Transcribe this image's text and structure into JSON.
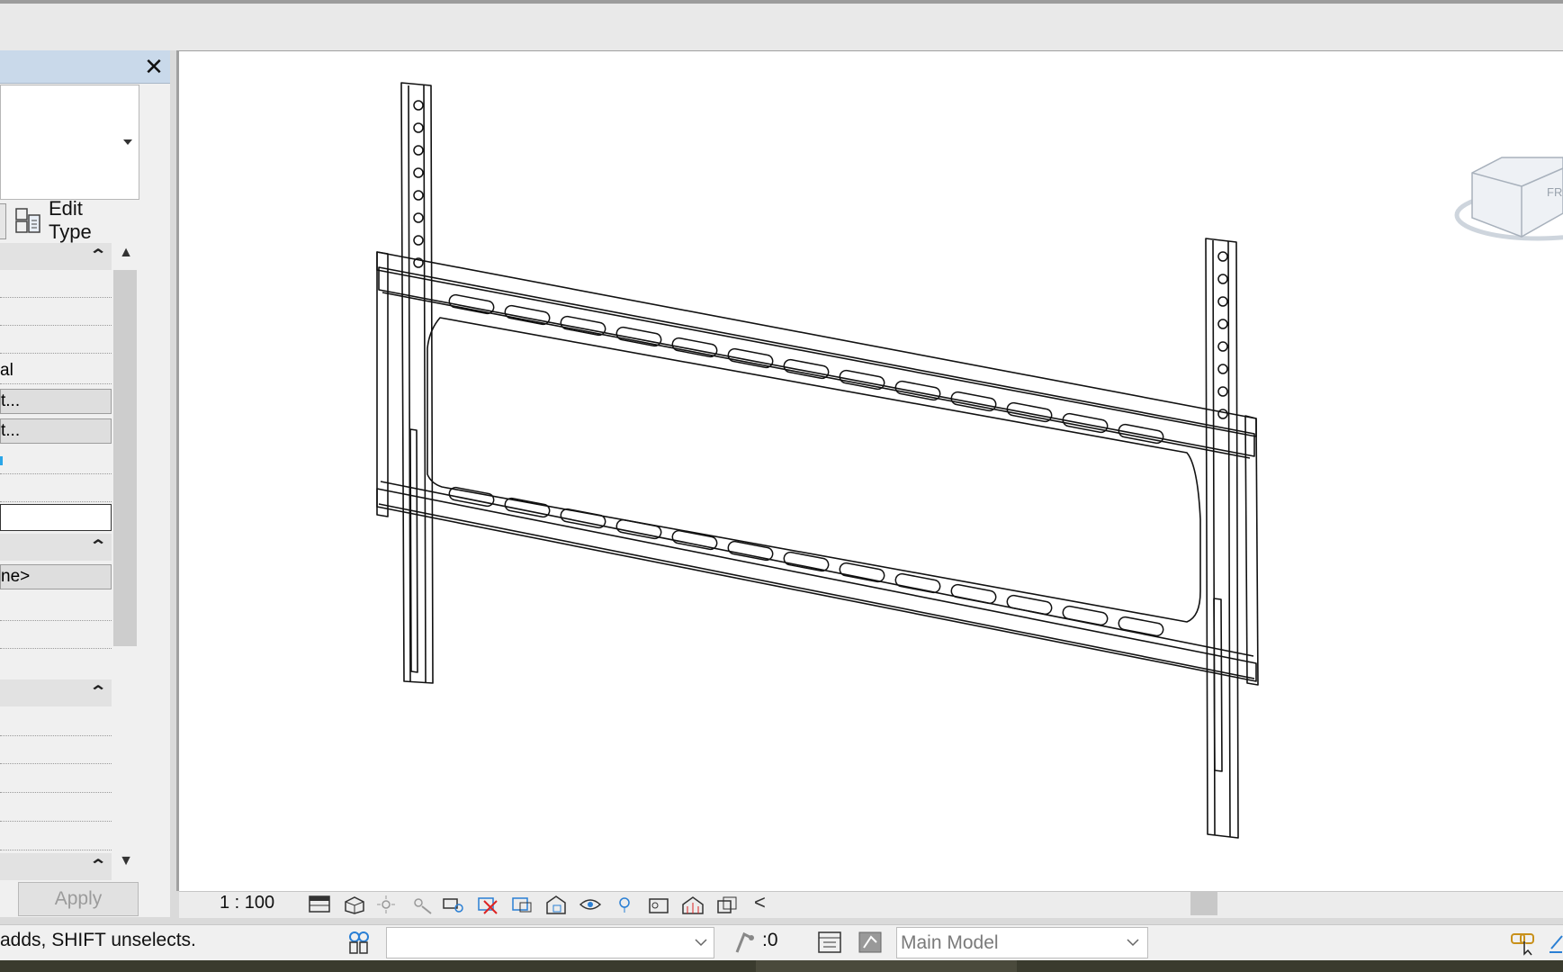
{
  "properties_palette": {
    "close_glyph": "✕",
    "edit_type_label": "Edit Type",
    "groups": [
      {
        "collapse_glyph": "⌃"
      },
      {
        "collapse_glyph": "⌃"
      },
      {
        "collapse_glyph": "⌃"
      },
      {
        "collapse_glyph": "⌃"
      }
    ],
    "rows": [
      "",
      "",
      "",
      "al",
      "t...",
      "t...",
      "",
      "",
      "",
      "ne>",
      "",
      "",
      "",
      "",
      "",
      "",
      "",
      ""
    ],
    "apply_label": "Apply"
  },
  "view_control_bar": {
    "scale": "1 : 100",
    "icons": [
      "detail-level-icon",
      "visual-style-icon",
      "sun-path-icon",
      "shadows-icon",
      "show-rendering-icon",
      "crop-view-icon",
      "show-crop-region-icon",
      "unlock-3d-view-icon",
      "temporary-hide-icon",
      "reveal-hidden-icon",
      "temporary-view-properties-icon",
      "show-analytical-model-icon",
      "highlight-displacement-icon",
      "reveal-constraints-icon"
    ],
    "collapse_glyph": "<"
  },
  "status_bar": {
    "message": "adds, SHIFT unselects.",
    "workset_value": "",
    "press_drag_count": ":0",
    "main_model": "Main Model"
  },
  "view_cube": {
    "face_label": "FR"
  },
  "colors": {
    "palette_title": "#c9d9ea",
    "view_background": "#ffffff",
    "accent_blue": "#2a7fd4"
  }
}
